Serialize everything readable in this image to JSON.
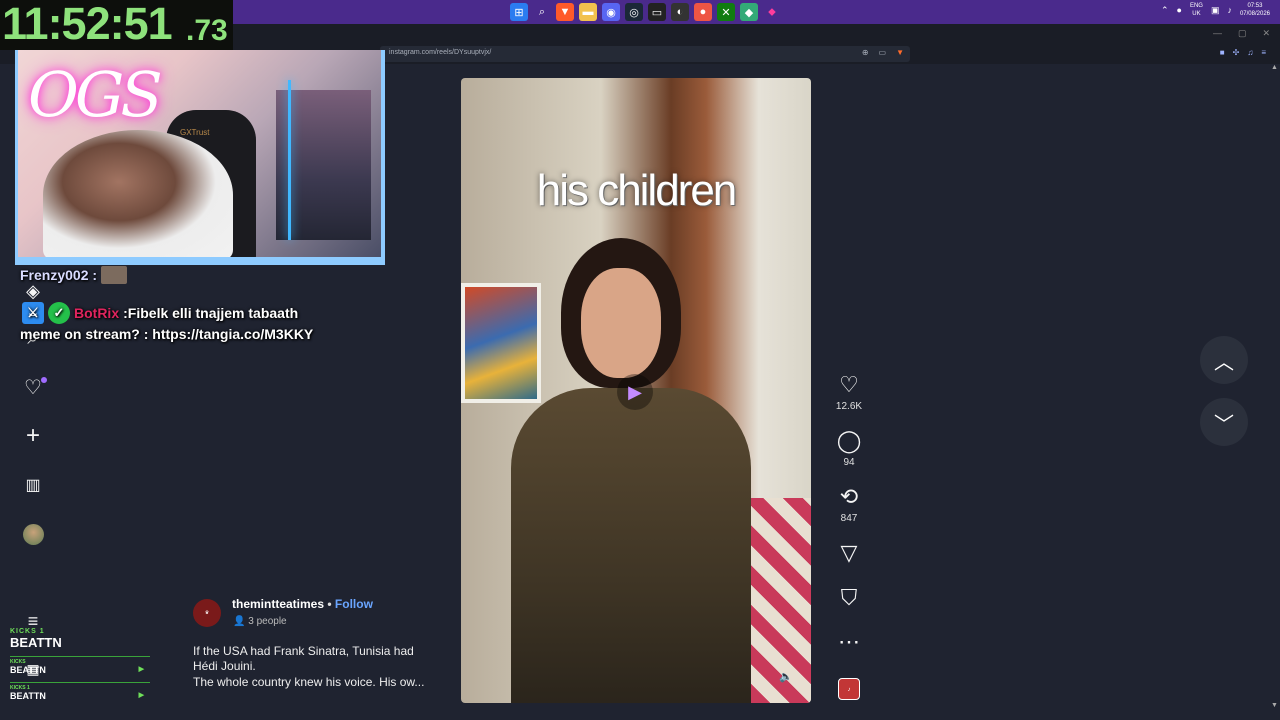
{
  "stream_timer": {
    "main": "11:52:51",
    "centiseconds": ".73"
  },
  "taskbar": {
    "apps": [
      "start-icon",
      "search-icon",
      "brave-icon",
      "folder-icon",
      "discord-icon",
      "steam-icon",
      "terminal-icon",
      "obs-icon",
      "chrome-icon",
      "xbox-icon",
      "game-icon",
      "maps-icon"
    ],
    "lang_top": "ENG",
    "lang_bottom": "UK",
    "time": "07:53",
    "date": "07/08/2026"
  },
  "browser": {
    "url": "instagram.com/reels/DYsuuptvjx/"
  },
  "webcam": {
    "neon_sign": "OGS",
    "chair_brand": "GXTrust"
  },
  "chat": {
    "user1": "Frenzy002 :",
    "bot_name": "BotRix",
    "bot_message": ":Fibelk elli tnajjem tabaath",
    "bot_message_cont": "meme on stream? : https://tangia.co/M3KKY"
  },
  "kicks": {
    "label": "KICKS 1",
    "top_name": "BEATTN",
    "rows": [
      {
        "small": "KICKS",
        "name": "BEATTN"
      },
      {
        "small": "KICKS 1",
        "name": "BEATTN"
      },
      {
        "small": "KICKS 50",
        "name": ""
      }
    ]
  },
  "reel": {
    "overlay_text": "his children",
    "likes": "12.6K",
    "comments": "94",
    "reposts": "847"
  },
  "post": {
    "username": "themintteatimes",
    "separator": "•",
    "follow_label": "Follow",
    "people": "3 people",
    "caption_line1": "If the USA had Frank Sinatra, Tunisia had Hédi Jouini.",
    "caption_line2": "The whole country knew his voice. His ow..."
  },
  "colors": {
    "accent": "#6aa5ff",
    "timer": "#8ee27c",
    "taskbar": "#4a2a8c",
    "bot": "#e0245e"
  }
}
